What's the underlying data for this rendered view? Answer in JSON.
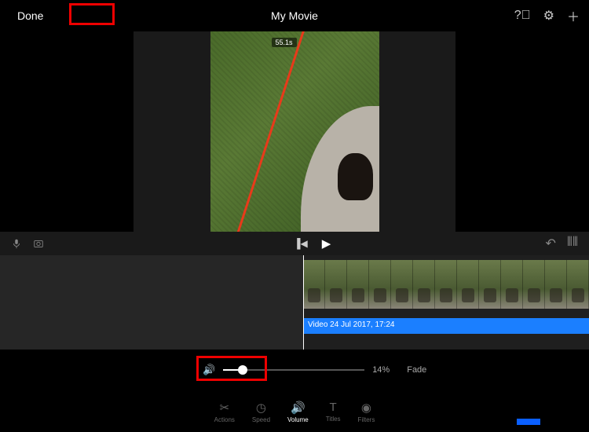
{
  "header": {
    "done_label": "Done",
    "title": "My Movie"
  },
  "preview": {
    "time_badge": "55.1s"
  },
  "timeline": {
    "clip_label": "Video 24 Jul 2017, 17:24"
  },
  "volume": {
    "percent_label": "14%",
    "fade_label": "Fade"
  },
  "tabs": {
    "actions": "Actions",
    "speed": "Speed",
    "volume": "Volume",
    "titles": "Titles",
    "filters": "Filters"
  }
}
